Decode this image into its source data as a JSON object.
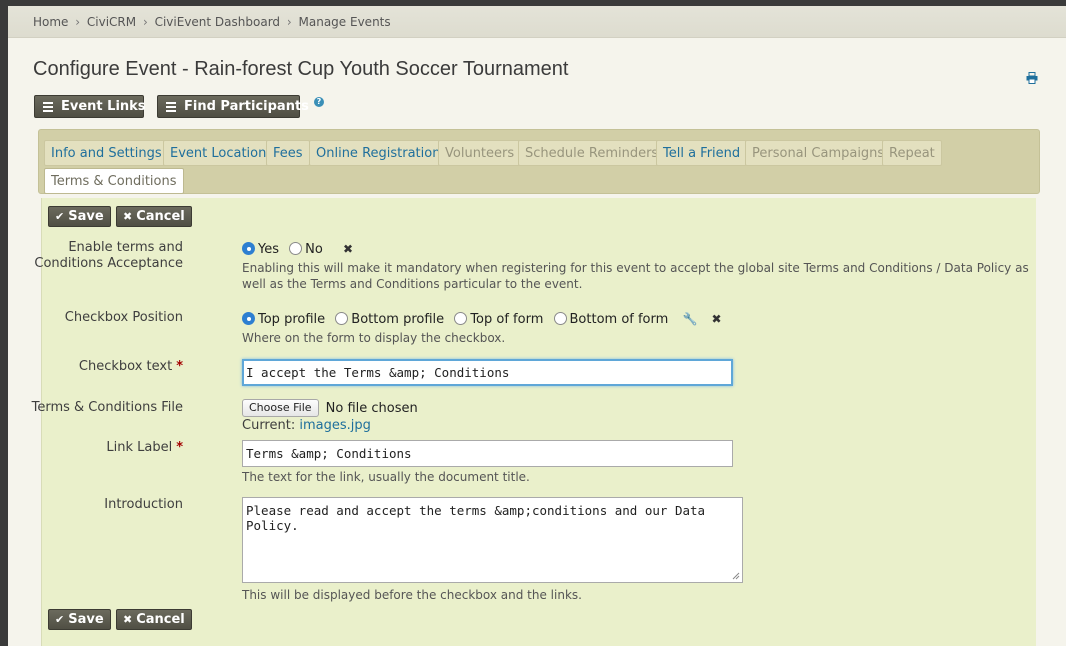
{
  "breadcrumb": [
    "Home",
    "CiviCRM",
    "CiviEvent Dashboard",
    "Manage Events"
  ],
  "page_title": "Configure Event - Rain-forest Cup Youth Soccer Tournament",
  "actions": {
    "event_links": "Event Links",
    "find_participants": "Find Participants"
  },
  "help_icon": "?",
  "tabs": [
    {
      "label": "Info and Settings",
      "state": "enabled"
    },
    {
      "label": "Event Location",
      "state": "enabled"
    },
    {
      "label": "Fees",
      "state": "enabled"
    },
    {
      "label": "Online Registration",
      "state": "enabled"
    },
    {
      "label": "Volunteers",
      "state": "disabled"
    },
    {
      "label": "Schedule Reminders",
      "state": "disabled"
    },
    {
      "label": "Tell a Friend",
      "state": "enabled"
    },
    {
      "label": "Personal Campaigns",
      "state": "disabled"
    },
    {
      "label": "Repeat",
      "state": "disabled"
    },
    {
      "label": "Terms & Conditions",
      "state": "active"
    }
  ],
  "buttons": {
    "save": "Save",
    "cancel": "Cancel"
  },
  "form": {
    "enable_terms": {
      "label_line1": "Enable terms and",
      "label_line2": "Conditions Acceptance",
      "options": [
        "Yes",
        "No"
      ],
      "selected": "Yes",
      "help_line1": "Enabling this will make it mandatory when registering for this event to accept the global site Terms and Conditions / Data Policy as",
      "help_line2": "well as the Terms and Conditions particular to the event."
    },
    "checkbox_position": {
      "label": "Checkbox Position",
      "options": [
        "Top profile",
        "Bottom profile",
        "Top of form",
        "Bottom of form"
      ],
      "selected": "Top profile",
      "help": "Where on the form to display the checkbox."
    },
    "checkbox_text": {
      "label": "Checkbox text",
      "required_mark": "*",
      "value": "I accept the Terms &amp; Conditions"
    },
    "terms_file": {
      "label": "Terms & Conditions File",
      "choose_button": "Choose File",
      "no_file_text": "No file chosen",
      "current_label": "Current:",
      "current_file": "images.jpg"
    },
    "link_label": {
      "label": "Link Label",
      "required_mark": "*",
      "value": "Terms &amp; Conditions",
      "help": "The text for the link, usually the document title."
    },
    "introduction": {
      "label": "Introduction",
      "value": "Please read and accept the terms &amp;conditions and our Data Policy.",
      "help": "This will be displayed before the checkbox and the links."
    }
  },
  "colors": {
    "tab_link": "#1f6f9c",
    "tab_disabled": "#98957d",
    "form_background": "#eaf0cb",
    "tabs_background": "#d2cfa7",
    "button_background": "#504f44",
    "radio_selected": "#2d7fd1",
    "required": "#a30000"
  },
  "icons": {
    "print": "printer-icon",
    "menu": "hamburger-icon",
    "check": "check-icon",
    "cancel": "close-icon",
    "clear": "clear-x-icon",
    "wrench": "wrench-icon",
    "help": "help-icon"
  }
}
